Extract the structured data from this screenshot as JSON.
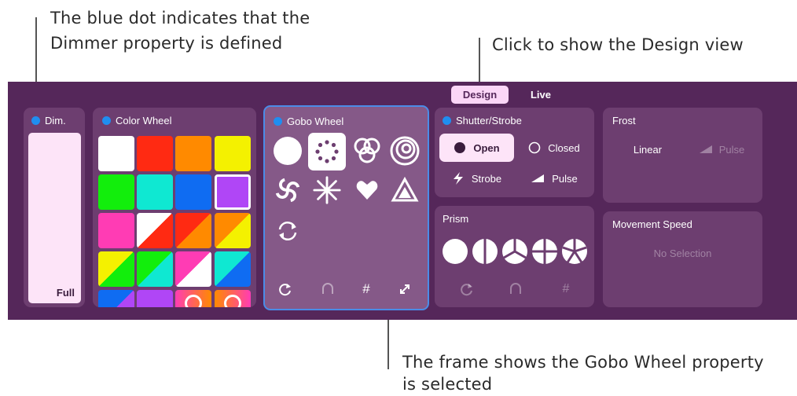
{
  "callouts": {
    "dimmer_line1": "The blue dot indicates that the",
    "dimmer_line2": "Dimmer property is defined",
    "design": "Click to show the Design view",
    "frame_line1": "The frame shows the Gobo Wheel property",
    "frame_line2": "is selected"
  },
  "tabs": {
    "design": "Design",
    "live": "Live"
  },
  "dimmer": {
    "title": "Dim.",
    "value": "Full"
  },
  "color_wheel": {
    "title": "Color Wheel"
  },
  "gobo_wheel": {
    "title": "Gobo Wheel",
    "footer": {
      "hash": "#"
    }
  },
  "shutter": {
    "title": "Shutter/Strobe",
    "open": "Open",
    "closed": "Closed",
    "strobe": "Strobe",
    "pulse": "Pulse"
  },
  "frost": {
    "title": "Frost",
    "linear": "Linear",
    "pulse": "Pulse"
  },
  "prism": {
    "title": "Prism",
    "hash": "#"
  },
  "movement": {
    "title": "Movement Speed",
    "empty": "No Selection"
  },
  "colors": {
    "panel": "#55275a",
    "card": "#6d3e70",
    "selected_card": "#855988",
    "accent_blue": "#1f8ef0",
    "design_tab": "#fbd6f7"
  }
}
